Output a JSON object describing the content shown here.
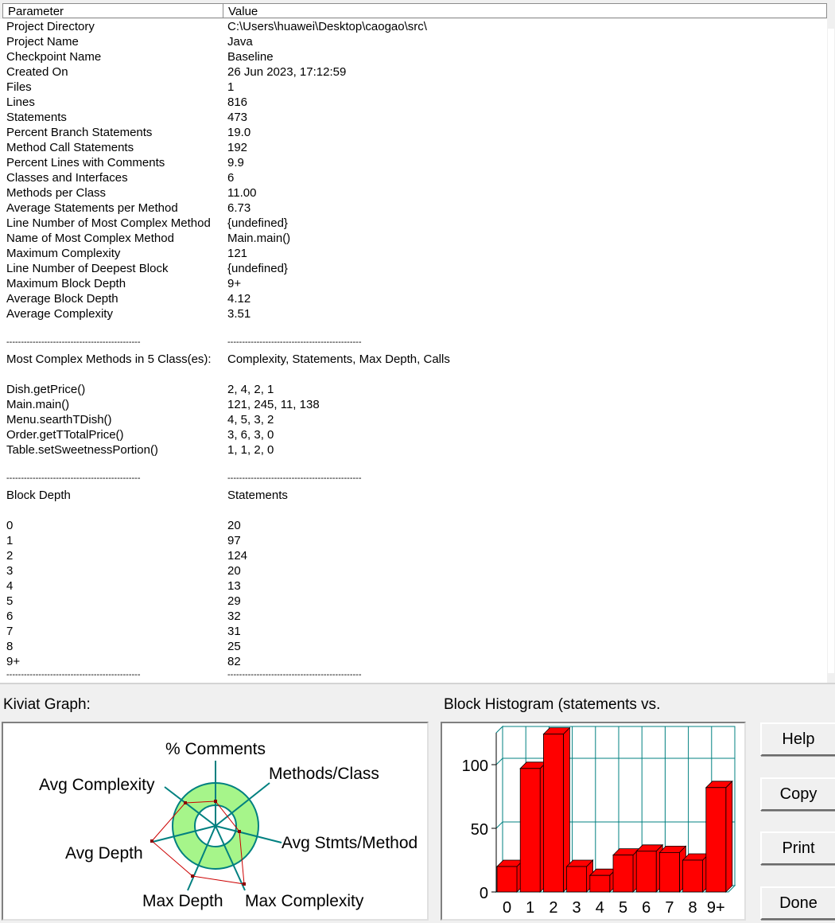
{
  "list": {
    "columns": {
      "parameter": "Parameter",
      "value": "Value"
    },
    "separator": "----------------------------------------------",
    "rows": [
      {
        "p": "Project Directory",
        "v": "C:\\Users\\huawei\\Desktop\\caogao\\src\\"
      },
      {
        "p": "Project Name",
        "v": "Java"
      },
      {
        "p": "Checkpoint Name",
        "v": "Baseline"
      },
      {
        "p": "Created On",
        "v": "26 Jun 2023, 17:12:59"
      },
      {
        "p": "Files",
        "v": "1"
      },
      {
        "p": "Lines",
        "v": "816"
      },
      {
        "p": "Statements",
        "v": "473"
      },
      {
        "p": "Percent Branch Statements",
        "v": "19.0"
      },
      {
        "p": "Method Call Statements",
        "v": "192"
      },
      {
        "p": "Percent Lines with Comments",
        "v": "9.9"
      },
      {
        "p": "Classes and Interfaces",
        "v": "6"
      },
      {
        "p": "Methods per Class",
        "v": "11.00"
      },
      {
        "p": "Average Statements per Method",
        "v": "6.73"
      },
      {
        "p": "Line Number of Most Complex Method",
        "v": "{undefined}"
      },
      {
        "p": "Name of Most Complex Method",
        "v": "Main.main()"
      },
      {
        "p": "Maximum Complexity",
        "v": "121"
      },
      {
        "p": "Line Number of Deepest Block",
        "v": "{undefined}"
      },
      {
        "p": "Maximum Block Depth",
        "v": "9+"
      },
      {
        "p": "Average Block Depth",
        "v": "4.12"
      },
      {
        "p": "Average Complexity",
        "v": "3.51"
      },
      {
        "blank": true
      },
      {
        "sep": true
      },
      {
        "p": "Most Complex Methods in 5 Class(es):",
        "v": "Complexity, Statements, Max Depth, Calls"
      },
      {
        "blank": true
      },
      {
        "p": "Dish.getPrice()",
        "v": "2, 4, 2, 1"
      },
      {
        "p": "Main.main()",
        "v": "121, 245, 11, 138"
      },
      {
        "p": "Menu.searthTDish()",
        "v": "4, 5, 3, 2"
      },
      {
        "p": "Order.getTTotalPrice()",
        "v": "3, 6, 3, 0"
      },
      {
        "p": "Table.setSweetnessPortion()",
        "v": "1, 1, 2, 0"
      },
      {
        "blank": true
      },
      {
        "sep": true
      },
      {
        "p": "Block Depth",
        "v": "Statements"
      },
      {
        "blank": true
      },
      {
        "p": "0",
        "v": "20"
      },
      {
        "p": "1",
        "v": "97"
      },
      {
        "p": "2",
        "v": "124"
      },
      {
        "p": "3",
        "v": "20"
      },
      {
        "p": "4",
        "v": "13"
      },
      {
        "p": "5",
        "v": "29"
      },
      {
        "p": "6",
        "v": "32"
      },
      {
        "p": "7",
        "v": "31"
      },
      {
        "p": "8",
        "v": "25"
      },
      {
        "p": "9+",
        "v": "82"
      },
      {
        "sep": true
      }
    ]
  },
  "kiviat": {
    "label": "Kiviat Graph:",
    "axes": {
      "comments": "% Comments",
      "methods_class": "Methods/Class",
      "avg_stmts": "Avg Stmts/Method",
      "max_complexity": "Max Complexity",
      "max_depth": "Max Depth",
      "avg_depth": "Avg Depth",
      "avg_complexity": "Avg Complexity"
    }
  },
  "chart_data": {
    "type": "bar",
    "title": "Block Histogram (statements vs.",
    "categories": [
      "0",
      "1",
      "2",
      "3",
      "4",
      "5",
      "6",
      "7",
      "8",
      "9+"
    ],
    "values": [
      20,
      97,
      124,
      20,
      13,
      29,
      32,
      31,
      25,
      82
    ],
    "yticks": [
      "0",
      "50",
      "100"
    ],
    "ylim": [
      0,
      125
    ],
    "grid": true,
    "bar_color": "#ff0000",
    "grid_color": "#008080"
  },
  "buttons": {
    "help": "Help",
    "copy": "Copy",
    "print": "Print",
    "done": "Done"
  }
}
